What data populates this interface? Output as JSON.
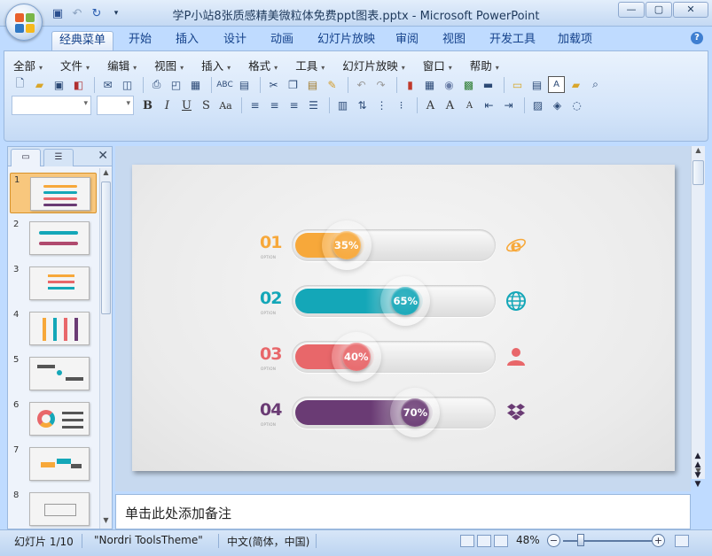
{
  "window": {
    "title": "学P小站8张质感精美微粒体免费ppt图表.pptx - Microsoft PowerPoint"
  },
  "ribbon_tabs": [
    "经典菜单",
    "开始",
    "插入",
    "设计",
    "动画",
    "幻灯片放映",
    "审阅",
    "视图",
    "开发工具",
    "加载项"
  ],
  "menus": [
    "全部",
    "文件",
    "编辑",
    "视图",
    "插入",
    "格式",
    "工具",
    "幻灯片放映",
    "窗口",
    "帮助"
  ],
  "slides_pane": {
    "numbers": [
      "1",
      "2",
      "3",
      "4",
      "5",
      "6",
      "7",
      "8"
    ]
  },
  "slide": {
    "rows": [
      {
        "number": "01",
        "option": "OPTION",
        "percent_label": "35%",
        "value": 35,
        "color": "#f7a83a",
        "icon": "ie-icon"
      },
      {
        "number": "02",
        "option": "OPTION",
        "percent_label": "65%",
        "value": 65,
        "color": "#14a7b8",
        "icon": "globe-icon"
      },
      {
        "number": "03",
        "option": "OPTION",
        "percent_label": "40%",
        "value": 40,
        "color": "#e8676a",
        "icon": "user-icon"
      },
      {
        "number": "04",
        "option": "OPTION",
        "percent_label": "70%",
        "value": 70,
        "color": "#6a3b74",
        "icon": "dropbox-icon"
      }
    ]
  },
  "notes": {
    "placeholder": "单击此处添加备注"
  },
  "status": {
    "slide_info": "幻灯片 1/10",
    "theme": "\"Nordri ToolsTheme\"",
    "language": "中文(简体，中国)",
    "zoom": "48%"
  }
}
